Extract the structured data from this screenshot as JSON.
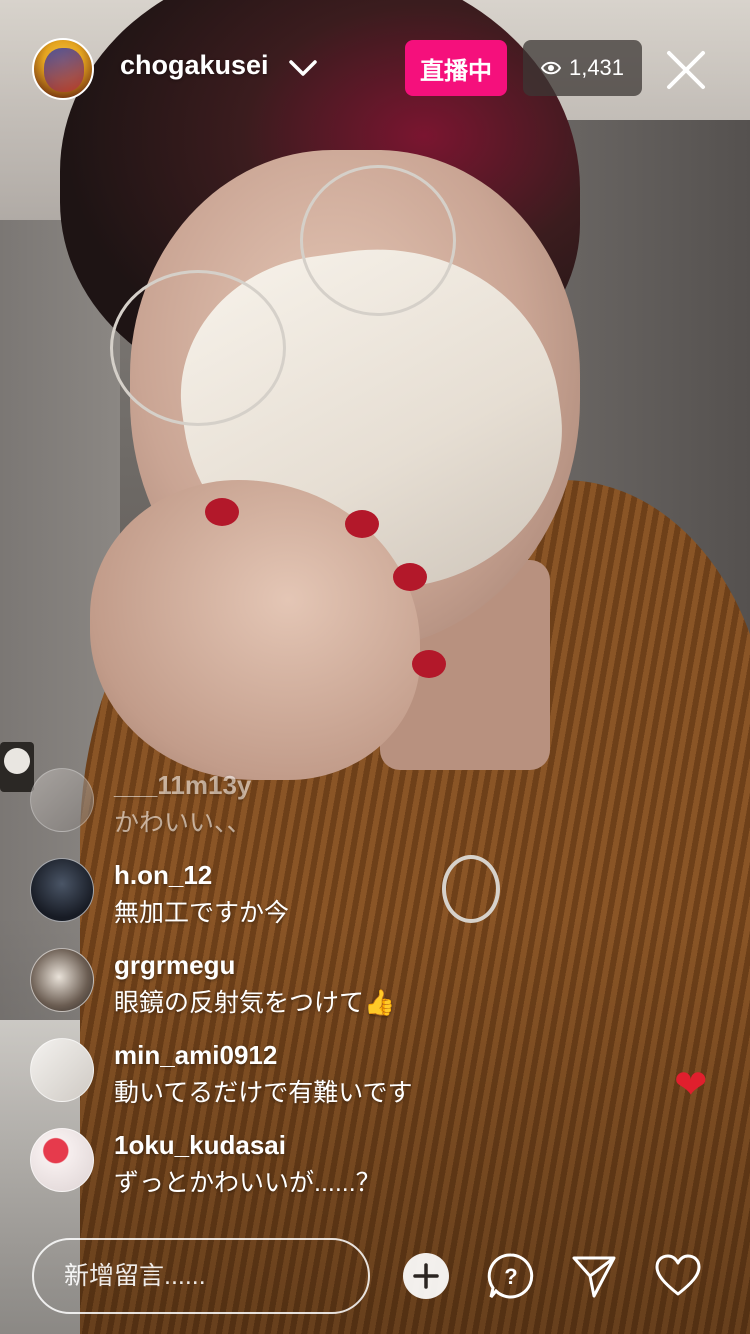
{
  "header": {
    "username": "chogakusei",
    "live_label": "直播中",
    "viewer_count": "1,431"
  },
  "comments": [
    {
      "user": "___11m13y",
      "message": "かわいい、、"
    },
    {
      "user": "h.on_12",
      "message": "無加工ですか今"
    },
    {
      "user": "grgrmegu",
      "message": "眼鏡の反射気をつけて👍"
    },
    {
      "user": "min_ami0912",
      "message": "動いてるだけで有難いです"
    },
    {
      "user": "1oku_kudasai",
      "message": "ずっとかわいいが......？"
    }
  ],
  "footer": {
    "comment_placeholder": "新增留言......"
  },
  "icons": {
    "chevron": "chevron-down-icon",
    "viewers": "eye-icon",
    "close": "close-icon",
    "add": "add-circle-icon",
    "question": "question-icon",
    "send": "send-icon",
    "like": "heart-icon"
  },
  "colors": {
    "live_badge": "#f5107c",
    "floating_heart": "#e01f2d"
  }
}
